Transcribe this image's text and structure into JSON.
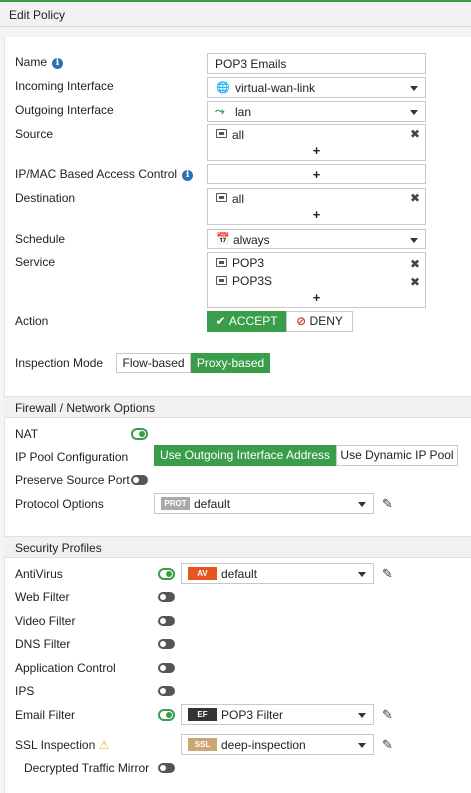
{
  "window": {
    "title": "Edit Policy"
  },
  "fields": {
    "name": {
      "label": "Name",
      "value": "POP3 Emails"
    },
    "incoming_interface": {
      "label": "Incoming Interface",
      "value": "virtual-wan-link"
    },
    "outgoing_interface": {
      "label": "Outgoing Interface",
      "value": "lan"
    },
    "source": {
      "label": "Source",
      "items": [
        "all"
      ]
    },
    "ip_mac_access_control": {
      "label": "IP/MAC Based Access Control"
    },
    "destination": {
      "label": "Destination",
      "items": [
        "all"
      ]
    },
    "schedule": {
      "label": "Schedule",
      "value": "always"
    },
    "service": {
      "label": "Service",
      "items": [
        "POP3",
        "POP3S"
      ]
    },
    "action": {
      "label": "Action",
      "accept": "ACCEPT",
      "deny": "DENY",
      "selected": "ACCEPT"
    },
    "inspection_mode": {
      "label": "Inspection Mode",
      "flow": "Flow-based",
      "proxy": "Proxy-based",
      "selected": "Proxy-based"
    }
  },
  "firewall_section": {
    "title": "Firewall / Network Options",
    "nat": {
      "label": "NAT",
      "enabled": true
    },
    "ip_pool": {
      "label": "IP Pool Configuration",
      "option1": "Use Outgoing Interface Address",
      "option2": "Use Dynamic IP Pool",
      "selected": "Use Outgoing Interface Address"
    },
    "preserve_source_port": {
      "label": "Preserve Source Port",
      "enabled": false
    },
    "protocol_options": {
      "label": "Protocol Options",
      "badge": "PROT",
      "value": "default"
    }
  },
  "security_section": {
    "title": "Security Profiles",
    "antivirus": {
      "label": "AntiVirus",
      "enabled": true,
      "badge": "AV",
      "value": "default",
      "badge_color": "#e8541e"
    },
    "web_filter": {
      "label": "Web Filter",
      "enabled": false
    },
    "video_filter": {
      "label": "Video Filter",
      "enabled": false
    },
    "dns_filter": {
      "label": "DNS Filter",
      "enabled": false
    },
    "application_control": {
      "label": "Application Control",
      "enabled": false
    },
    "ips": {
      "label": "IPS",
      "enabled": false
    },
    "email_filter": {
      "label": "Email Filter",
      "enabled": true,
      "badge": "EF",
      "value": "POP3 Filter",
      "badge_color": "#333333"
    },
    "ssl_inspection": {
      "label": "SSL Inspection",
      "badge": "SSL",
      "value": "deep-inspection",
      "badge_color": "#c9a875"
    },
    "decrypted_traffic_mirror": {
      "label": "Decrypted Traffic Mirror",
      "enabled": false
    }
  },
  "colors": {
    "accent": "#3a9d49",
    "info": "#2f6fb3",
    "warning": "#f0b323"
  }
}
